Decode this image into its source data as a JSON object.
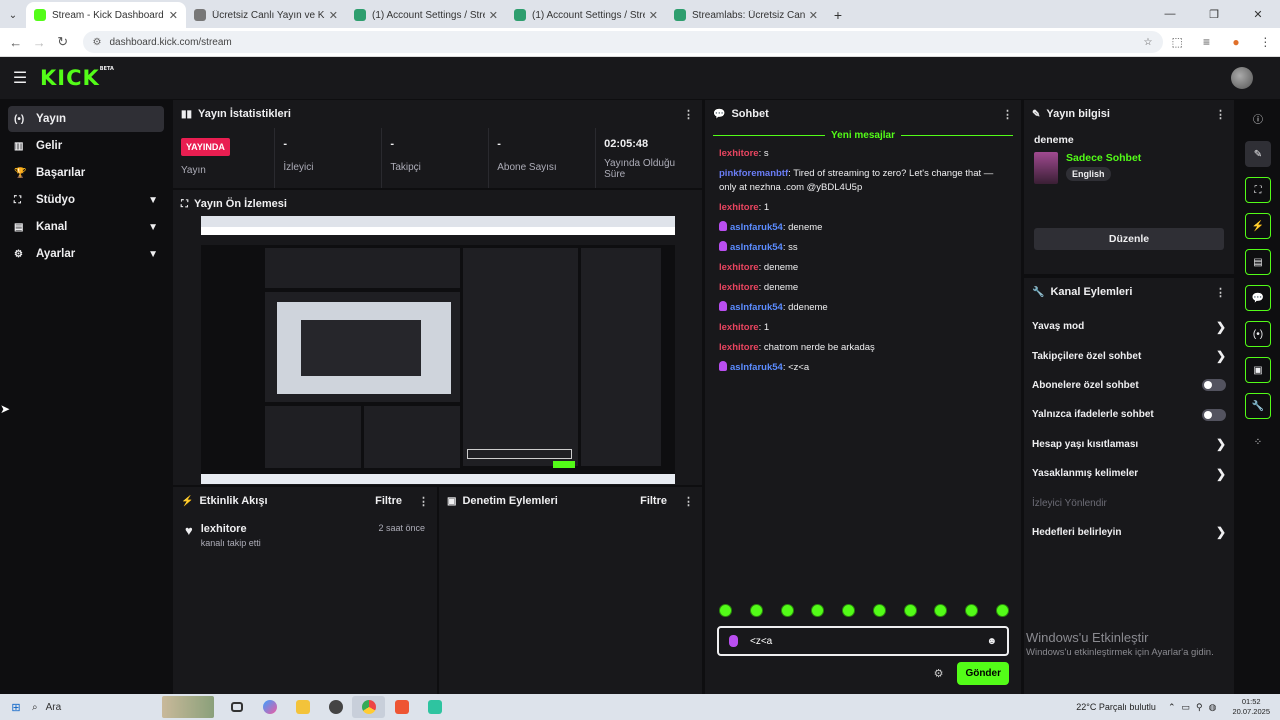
{
  "browser": {
    "tabs": [
      {
        "title": "Stream - Kick Dashboard",
        "fav_color": "#53fc18",
        "active": true
      },
      {
        "title": "Ücretsiz Canlı Yayın ve Kayıt Ya...",
        "fav_color": "#777777",
        "active": false
      },
      {
        "title": "(1) Account Settings / Streamla...",
        "fav_color": "#2e9e6e",
        "active": false
      },
      {
        "title": "(1) Account Settings / Streamla...",
        "fav_color": "#2e9e6e",
        "active": false
      },
      {
        "title": "Streamlabs: Ücretsiz Canlı Yayı...",
        "fav_color": "#2e9e6e",
        "active": false
      }
    ],
    "url": "dashboard.kick.com/stream"
  },
  "header": {
    "logo": "KICK",
    "logo_sup": "BETA"
  },
  "sidebar": {
    "items": [
      {
        "label": "Yayın",
        "icon": "broadcast-icon",
        "glyph": "(•)",
        "active": true,
        "has_chevron": false
      },
      {
        "label": "Gelir",
        "icon": "revenue-icon",
        "glyph": "▥",
        "active": false,
        "has_chevron": false
      },
      {
        "label": "Başarılar",
        "icon": "trophy-icon",
        "glyph": "🏆",
        "active": false,
        "has_chevron": false
      },
      {
        "label": "Stüdyo",
        "icon": "studio-icon",
        "glyph": "⛶",
        "active": false,
        "has_chevron": true
      },
      {
        "label": "Kanal",
        "icon": "channel-icon",
        "glyph": "▤",
        "active": false,
        "has_chevron": true
      },
      {
        "label": "Ayarlar",
        "icon": "settings-icon",
        "glyph": "⚙",
        "active": false,
        "has_chevron": true
      }
    ]
  },
  "stats": {
    "title": "Yayın İstatistikleri",
    "live_badge": "YAYINDA",
    "live_label": "Yayın",
    "viewers_value": "-",
    "viewers_label": "İzleyici",
    "followers_value": "-",
    "followers_label": "Takipçi",
    "subs_value": "-",
    "subs_label": "Abone Sayısı",
    "duration_value": "02:05:48",
    "duration_label": "Yayında Olduğu Süre"
  },
  "preview": {
    "title": "Yayın Ön İzlemesi"
  },
  "activity": {
    "title": "Etkinlik Akışı",
    "filter": "Filtre",
    "items": [
      {
        "user": "lexhitore",
        "text": "kanalı takip etti",
        "time": "2 saat önce"
      }
    ]
  },
  "moderation": {
    "title": "Denetim Eylemleri",
    "filter": "Filtre"
  },
  "chat": {
    "title": "Sohbet",
    "new_messages": "Yeni mesajlar",
    "messages": [
      {
        "user": "lexhitore",
        "text": ": s",
        "color": "#e94560",
        "mic": false
      },
      {
        "user": "pinkforemanbtf",
        "text": ": Tired of streaming to zero? Let's change that — only at nezhna .com @yBDL4U5p",
        "color": "#6a7df5",
        "mic": false
      },
      {
        "user": "lexhitore",
        "text": ": 1",
        "color": "#e94560",
        "mic": false
      },
      {
        "user": "asInfaruk54",
        "text": ": deneme",
        "color": "#5b8cff",
        "mic": true
      },
      {
        "user": "asInfaruk54",
        "text": ": ss",
        "color": "#5b8cff",
        "mic": true
      },
      {
        "user": "lexhitore",
        "text": ": deneme",
        "color": "#e94560",
        "mic": false
      },
      {
        "user": "lexhitore",
        "text": ": deneme",
        "color": "#e94560",
        "mic": false
      },
      {
        "user": "asInfaruk54",
        "text": ": ddeneme",
        "color": "#5b8cff",
        "mic": true
      },
      {
        "user": "lexhitore",
        "text": ": 1",
        "color": "#e94560",
        "mic": false
      },
      {
        "user": "lexhitore",
        "text": ": chatrom nerde be arkadaş",
        "color": "#e94560",
        "mic": false
      },
      {
        "user": "asInfaruk54",
        "text": ": <z<a",
        "color": "#5b8cff",
        "mic": true
      }
    ],
    "input_value": "<z<a",
    "send_label": "Gönder"
  },
  "info": {
    "title": "Yayın bilgisi",
    "stream_title": "deneme",
    "category": "Sadece Sohbet",
    "language": "English",
    "edit_label": "Düzenle"
  },
  "actions": {
    "title": "Kanal Eylemleri",
    "items": [
      {
        "label": "Yavaş mod",
        "kind": "chevron"
      },
      {
        "label": "Takipçilere özel sohbet",
        "kind": "chevron"
      },
      {
        "label": "Abonelere özel sohbet",
        "kind": "toggle"
      },
      {
        "label": "Yalnızca ifadelerle sohbet",
        "kind": "toggle"
      },
      {
        "label": "Hesap yaşı kısıtlaması",
        "kind": "chevron"
      },
      {
        "label": "Yasaklanmış kelimeler",
        "kind": "chevron"
      },
      {
        "label": "İzleyici Yönlendir",
        "kind": "dim"
      },
      {
        "label": "Hedefleri belirleyin",
        "kind": "chevron"
      }
    ]
  },
  "watermark": {
    "line1": "Windows'u Etkinleştir",
    "line2": "Windows'u etkinleştirmek için Ayarlar'a gidin."
  },
  "taskbar": {
    "search": "Ara",
    "weather": "22°C  Parçalı bulutlu",
    "time": "01:52",
    "date": "20.07.2025"
  },
  "colors": {
    "accent": "#53fc18",
    "live": "#e91e51"
  }
}
